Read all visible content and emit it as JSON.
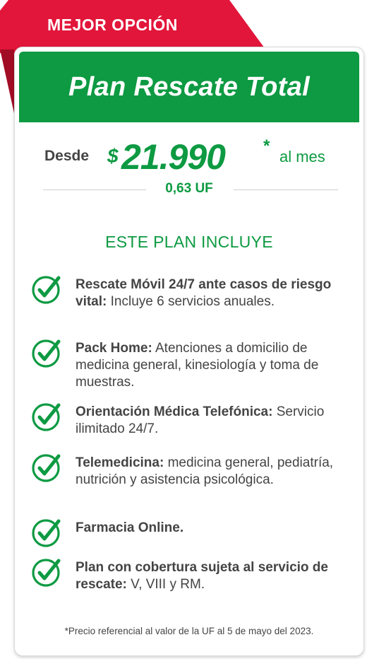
{
  "badge": {
    "label": "MEJOR OPCIÓN"
  },
  "plan": {
    "title": "Plan Rescate Total",
    "price_prefix": "Desde",
    "currency_symbol": "$",
    "price": "21.990",
    "price_note_mark": "*",
    "period": "al mes",
    "uf_value": "0,63 UF"
  },
  "includes": {
    "title": "ESTE PLAN INCLUYE",
    "items": [
      {
        "bold": "Rescate Móvil 24/7 ante casos de riesgo vital:",
        "text": " Incluye 6 servicios anuales."
      },
      {
        "bold": "Pack Home:",
        "text": " Atenciones a domicilio de medicina general, kinesiología y toma de muestras."
      },
      {
        "bold": "Orientación Médica Telefónica:",
        "text": " Servicio ilimitado 24/7."
      },
      {
        "bold": "Telemedicina:",
        "text": " medicina general, pediatría, nutrición y asistencia psicológica."
      },
      {
        "bold": "Farmacia Online.",
        "text": ""
      },
      {
        "bold": "Plan con cobertura sujeta al servicio de rescate:",
        "text": " V, VIII y RM."
      }
    ]
  },
  "footnote": "*Precio referencial al valor de la UF al 5 de mayo del 2023.",
  "colors": {
    "green": "#0d9a42",
    "red": "#e2163a",
    "text": "#444444"
  },
  "icons": {
    "feature": "check-circle-icon"
  }
}
